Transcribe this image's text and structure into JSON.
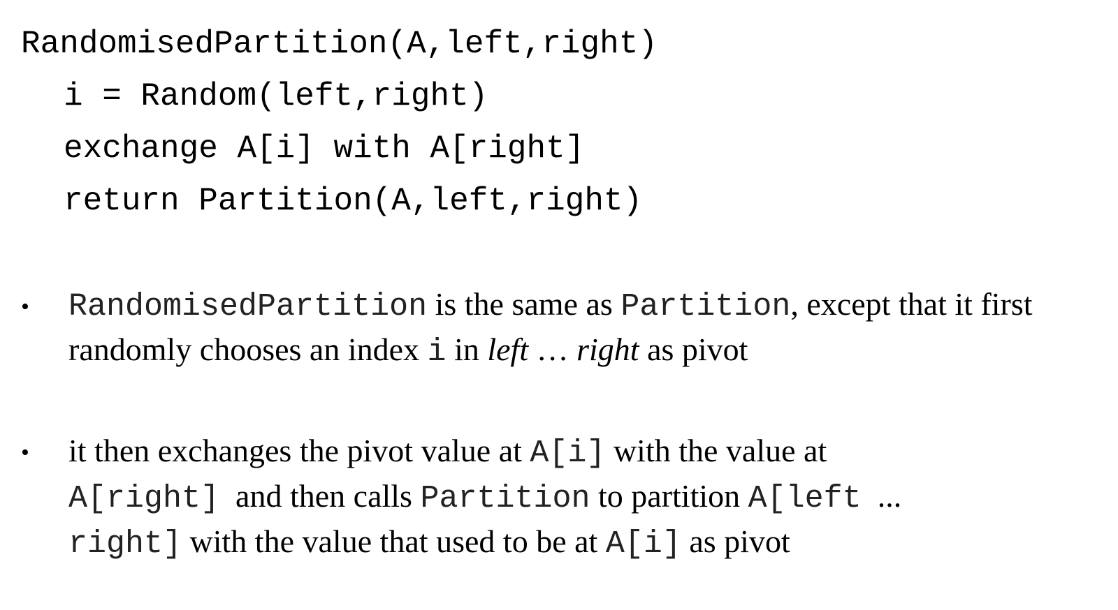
{
  "code": {
    "line1": "RandomisedPartition(A,left,right)",
    "line2": "i = Random(left,right)",
    "line3": "exchange A[i] with A[right]",
    "line4": "return Partition(A,left,right)"
  },
  "bullet_symbol": "•",
  "para1": {
    "s1_code": "RandomisedPartition",
    "s2": " is the same as ",
    "s3_code": "Partition",
    "s4": ", except that it first randomly chooses an index ",
    "s5_code": "i",
    "s6": " in ",
    "s7_italic": "left",
    "s8": " … ",
    "s9_italic": "right",
    "s10": " as pivot"
  },
  "para2": {
    "s1": "it then exchanges the pivot value at ",
    "s2_code": "A[i]",
    "s3": " with the value at ",
    "s4_code": "A[right]",
    "s5": "  and then calls ",
    "s6_code": "Partition",
    "s7": " to partition ",
    "s8_code": "A[left",
    "s9": "  ... ",
    "s10_code": "right]",
    "s11": " with the value that used to be at ",
    "s12_code": "A[i]",
    "s13": " as pivot"
  }
}
